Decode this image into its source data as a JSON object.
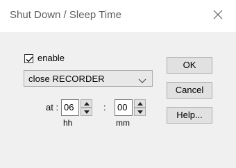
{
  "window": {
    "title": "Shut Down / Sleep Time"
  },
  "enable": {
    "label": "enable",
    "checked": true
  },
  "action_select": {
    "selected": "close RECORDER"
  },
  "time": {
    "at_label": "at :",
    "hour_value": "06",
    "separator": ":",
    "minute_value": "00",
    "hour_unit": "hh",
    "minute_unit": "mm"
  },
  "buttons": {
    "ok": "OK",
    "cancel": "Cancel",
    "help": "Help..."
  },
  "icons": {
    "close": "close-icon",
    "dropdown": "chevron-down-icon",
    "spin_up": "spin-up-icon",
    "spin_down": "spin-down-icon",
    "check": "checkmark-icon"
  }
}
